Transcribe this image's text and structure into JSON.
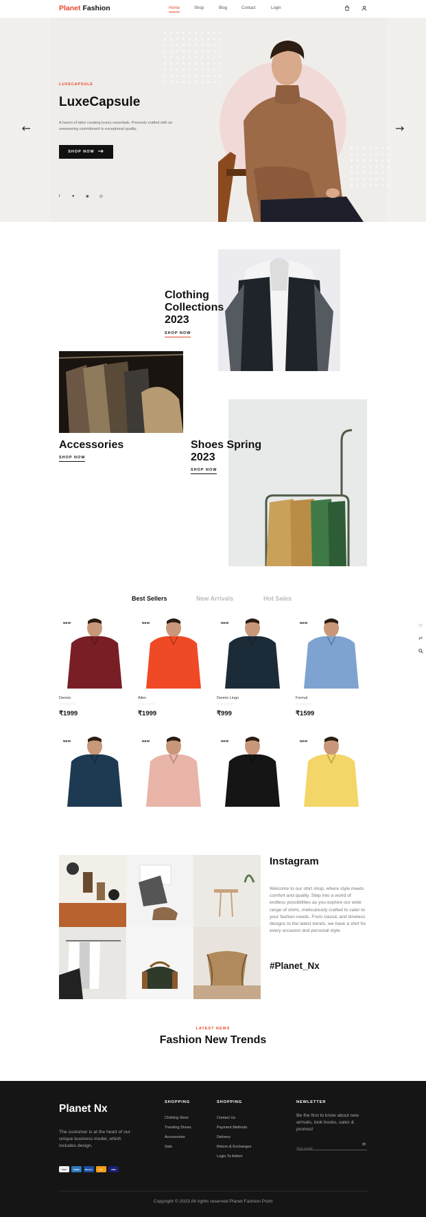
{
  "brand": {
    "part1": "Planet",
    "part2": "Fashion"
  },
  "nav": [
    {
      "label": "Home",
      "active": true
    },
    {
      "label": "Shop",
      "active": false
    },
    {
      "label": "Blog",
      "active": false
    },
    {
      "label": "Contact",
      "active": false
    },
    {
      "label": "Login",
      "active": false
    }
  ],
  "header_icons": [
    "bag-icon",
    "user-icon"
  ],
  "hero": {
    "eyebrow": "LUXECAPSULE",
    "title": "LuxeCapsule",
    "description": "A haven of tailor creating luxury essentials. Precisely crafted with an unwavering commitment to exceptional quality.",
    "button_label": "SHOP NOW",
    "social_icons": [
      "facebook-icon",
      "twitter-icon",
      "pinterest-icon",
      "instagram-icon"
    ]
  },
  "collections": [
    {
      "title": "Clothing Collections 2023",
      "link": "SHOP NOW"
    },
    {
      "title": "Accessories",
      "link": "SHOP NOW"
    },
    {
      "title": "Shoes Spring 2023",
      "link": "SHOP NOW"
    }
  ],
  "product_tabs": [
    {
      "label": "Best Sellers",
      "active": true
    },
    {
      "label": "New Arrivals",
      "active": false
    },
    {
      "label": "Hot Sales",
      "active": false
    }
  ],
  "side_icons": [
    "heart-icon",
    "compare-icon",
    "search-icon"
  ],
  "products": [
    {
      "badge": "NEW",
      "name": "Dennis",
      "rating": 0,
      "price": "₹1999",
      "color": "#7a1e25"
    },
    {
      "badge": "NEW",
      "name": "Allen",
      "rating": 0,
      "price": "₹1999",
      "color": "#ef4a25"
    },
    {
      "badge": "NEW",
      "name": "Dennis Lingo",
      "rating": 0,
      "price": "₹999",
      "color": "#1c2b38"
    },
    {
      "badge": "NEW",
      "name": "Formal",
      "rating": 0,
      "price": "₹1599",
      "color": "#7ea3d0"
    },
    {
      "badge": "NEW",
      "name": "",
      "rating": 0,
      "price": "",
      "color": "#1d3a52"
    },
    {
      "badge": "NEW",
      "name": "",
      "rating": 0,
      "price": "",
      "color": "#e9b5a8"
    },
    {
      "badge": "NEW",
      "name": "",
      "rating": 0,
      "price": "",
      "color": "#151515"
    },
    {
      "badge": "NEW",
      "name": "",
      "rating": 0,
      "price": "",
      "color": "#f3d667"
    }
  ],
  "instagram": {
    "title": "Instagram",
    "text": "Welcome to our shirt shop, where style meets comfort and quality. Step into a world of endless possibilities as you explore our wide range of shirts, meticulously crafted to cater to your fashion needs. From classic and timeless designs to the latest trends, we have a shirt for every occasion and personal style.",
    "hashtag": "#Planet_Nx"
  },
  "news": {
    "eyebrow": "LATEST NEWS",
    "title": "Fashion New Trends"
  },
  "footer": {
    "brand": "Planet Nx",
    "about": "The customer is at the heart of our unique business model, which includes design.",
    "col1": {
      "heading": "SHOPPING",
      "links": [
        "Clothing Store",
        "Trending Shoes",
        "Accessories",
        "Sale"
      ]
    },
    "col2": {
      "heading": "SHOPPING",
      "links": [
        "Contact Us",
        "Payment Methods",
        "Delivery",
        "Return & Exchanges",
        "Login To Admin"
      ]
    },
    "newsletter": {
      "heading": "NEWLETTER",
      "text": "Be the first to know about new arrivals, look books, sales & promos!",
      "placeholder": "Your email"
    },
    "payments": [
      "VISA",
      "AMEX",
      "Maestro",
      "MC",
      "VISA"
    ],
    "copyright": "Copyright © 2023 All rights reserved Planet Fashion Point"
  },
  "colors": {
    "accent": "#e8452c",
    "dark": "#151515",
    "hero_bg": "#f2f0ed"
  }
}
